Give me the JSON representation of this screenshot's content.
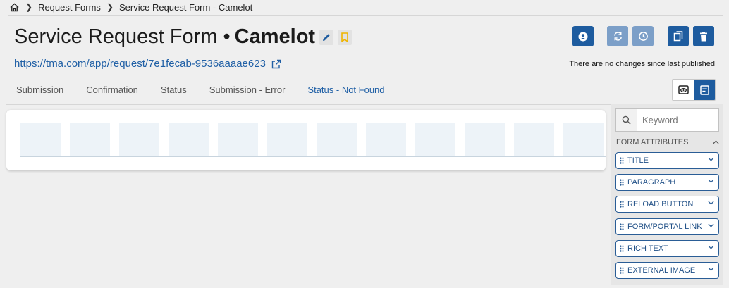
{
  "breadcrumb": {
    "items": [
      "Request Forms",
      "Service Request Form - Camelot"
    ]
  },
  "header": {
    "title_prefix": "Service Request Form",
    "title_separator": "•",
    "title_name": "Camelot",
    "url": "https://tma.com/app/request/7e1fecab-9536aaaae623",
    "publish_status": "There are no changes since last published"
  },
  "icons": {
    "home": "home-icon",
    "edit": "pencil-icon",
    "bookmark": "bookmark-icon",
    "external": "external-link-icon",
    "user": "user-icon",
    "sync": "sync-icon",
    "history": "history-icon",
    "copy": "copy-icon",
    "delete": "trash-icon",
    "preview": "eye-icon",
    "form": "form-icon",
    "search": "search-icon"
  },
  "tabs": [
    {
      "label": "Submission",
      "active": false
    },
    {
      "label": "Confirmation",
      "active": false
    },
    {
      "label": "Status",
      "active": false
    },
    {
      "label": "Submission - Error",
      "active": false
    },
    {
      "label": "Status - Not Found",
      "active": true
    }
  ],
  "panel": {
    "search_placeholder": "Keyword",
    "section_title": "FORM ATTRIBUTES",
    "items": [
      "TITLE",
      "PARAGRAPH",
      "RELOAD BUTTON",
      "FORM/PORTAL LINK",
      "RICH TEXT",
      "EXTERNAL IMAGE"
    ]
  },
  "colors": {
    "primary": "#1e5c9f",
    "primary_disabled": "#7c9fc8",
    "link": "#1f5fa5",
    "bookmark": "#f0b400",
    "background": "#efefef"
  }
}
